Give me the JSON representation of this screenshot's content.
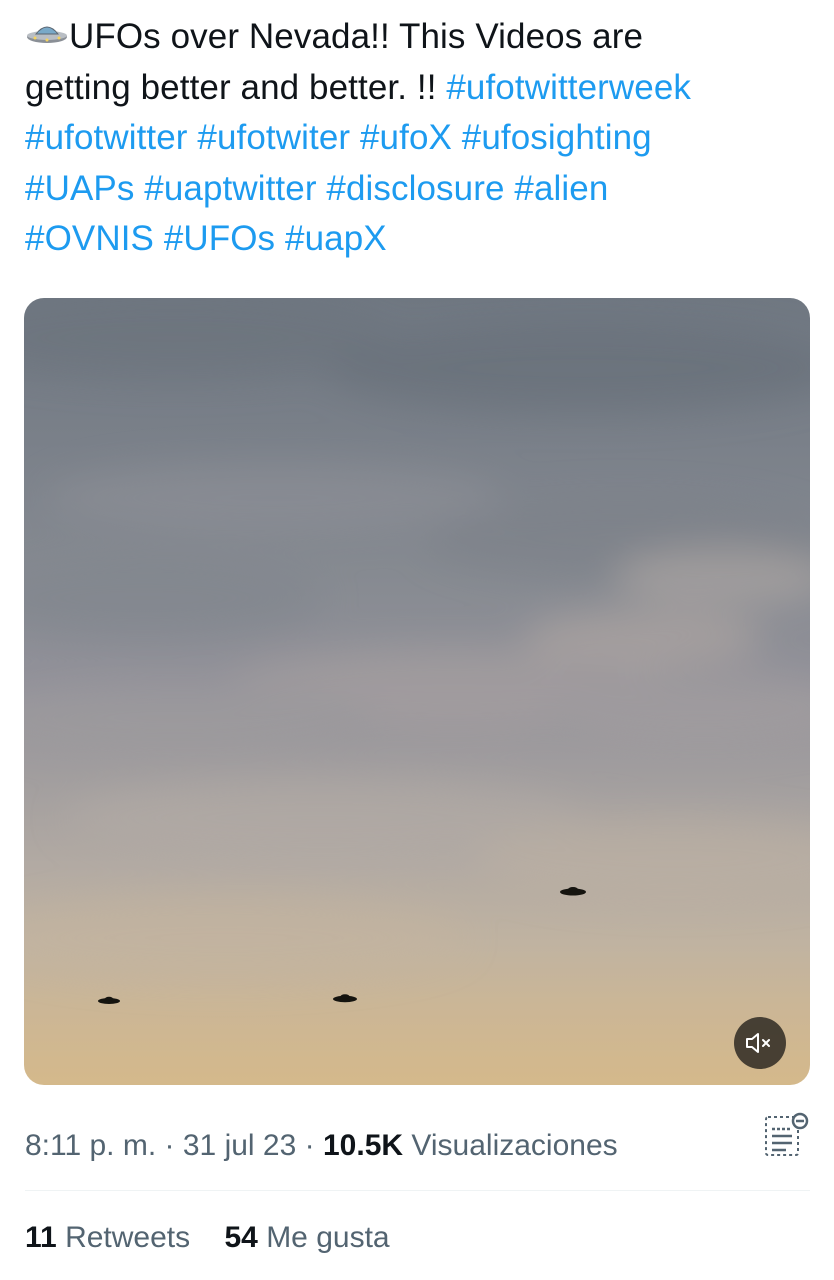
{
  "tweet": {
    "emoji_icon": "flying-saucer-icon",
    "text_parts": {
      "line1_text": "UFOs over Nevada!! This Videos are",
      "line2_text": "getting better and better. !! ",
      "line2_tag": "#ufotwitterweek",
      "line3_tags": [
        "#ufotwitter",
        "#ufotwiter",
        "#ufoX",
        "#ufosighting"
      ],
      "line4_tags": [
        "#UAPs",
        "#uaptwitter",
        "#disclosure",
        "#alien"
      ],
      "line5_tags": [
        "#OVNIS",
        "#UFOs",
        "#uapX"
      ]
    },
    "hashtag_color": "#1d9bf0"
  },
  "media": {
    "type": "video",
    "mute_icon": "speaker-muted-icon"
  },
  "meta": {
    "time": "8:11 p. m.",
    "separator": "·",
    "date": "31 jul 23",
    "views_count": "10.5K",
    "views_label": "Visualizaciones",
    "analytics_icon": "view-analytics-icon"
  },
  "stats": {
    "retweets_count": "11",
    "retweets_label": "Retweets",
    "likes_count": "54",
    "likes_label": "Me gusta"
  }
}
